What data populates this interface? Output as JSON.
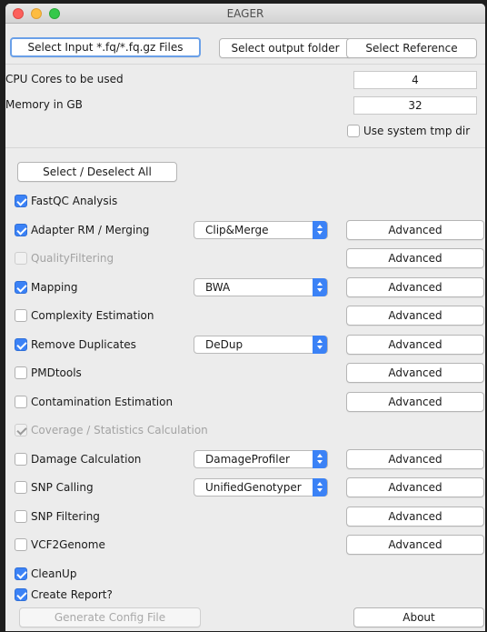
{
  "window": {
    "title": "EAGER"
  },
  "top_buttons": {
    "select_input": "Select Input *.fq/*.fq.gz Files",
    "select_output": "Select output folder",
    "select_reference": "Select Reference"
  },
  "settings": {
    "cpu_label": "CPU Cores to be used",
    "cpu_value": "4",
    "memory_label": "Memory in GB",
    "memory_value": "32",
    "tmp_label": "Use system tmp dir",
    "tmp_checked": false
  },
  "select_all_label": "Select / Deselect All",
  "advanced_label": "Advanced",
  "modules": [
    {
      "label": "FastQC Analysis",
      "checked": true,
      "enabled": true
    },
    {
      "label": "Adapter RM / Merging",
      "checked": true,
      "enabled": true,
      "select": "Clip&Merge",
      "advanced": true
    },
    {
      "label": "QualityFiltering",
      "checked": false,
      "enabled": false,
      "advanced": true
    },
    {
      "label": "Mapping",
      "checked": true,
      "enabled": true,
      "select": "BWA",
      "advanced": true
    },
    {
      "label": "Complexity Estimation",
      "checked": false,
      "enabled": true,
      "advanced": true
    },
    {
      "label": "Remove Duplicates",
      "checked": true,
      "enabled": true,
      "select": "DeDup",
      "advanced": true
    },
    {
      "label": "PMDtools",
      "checked": false,
      "enabled": true,
      "advanced": true
    },
    {
      "label": "Contamination Estimation",
      "checked": false,
      "enabled": true,
      "advanced": true
    },
    {
      "label": "Coverage / Statistics Calculation",
      "checked": true,
      "enabled": false
    },
    {
      "label": "Damage Calculation",
      "checked": false,
      "enabled": true,
      "select": "DamageProfiler",
      "advanced": true
    },
    {
      "label": "SNP Calling",
      "checked": false,
      "enabled": true,
      "select": "UnifiedGenotyper",
      "advanced": true
    },
    {
      "label": "SNP Filtering",
      "checked": false,
      "enabled": true,
      "advanced": true
    },
    {
      "label": "VCF2Genome",
      "checked": false,
      "enabled": true,
      "advanced": true
    },
    {
      "label": "CleanUp",
      "checked": true,
      "enabled": true
    }
  ],
  "footer": {
    "create_report_label": "Create Report?",
    "create_report_checked": true,
    "generate_config": "Generate Config File",
    "about": "About"
  }
}
